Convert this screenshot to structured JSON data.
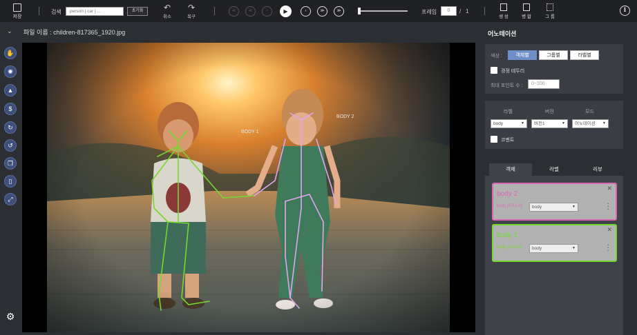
{
  "toolbar": {
    "save_label": "저장",
    "search_label": "검색",
    "search_placeholder": "person | car | ...",
    "reset_label": "초기화",
    "undo_label": "취소",
    "redo_label": "복구",
    "skip_back_2": "≪",
    "skip_back_1": "≪",
    "prev": "‹",
    "next": "›",
    "skip_fwd_1": "≫",
    "skip_fwd_2": "≫",
    "frame_label": "프레임",
    "frame_value": "0",
    "frame_sep": "/",
    "frame_total": "1",
    "create_label": "생 성",
    "merge_label": "병 합",
    "group_label": "그 룹",
    "info": "i"
  },
  "file": {
    "label": "파일 이름 : children-817365_1920.jpg"
  },
  "canvas_labels": {
    "body1": "BODY 1",
    "body2": "BODY 2"
  },
  "annotation": {
    "title": "어노테이션",
    "color_label": "색상 :",
    "color_buttons": [
      "객체별",
      "그룹별",
      "라벨별"
    ],
    "check_border": "경정 테두리",
    "max_points_label": "최대 포인트 수 :",
    "max_points_placeholder": "0~100",
    "label_header": "라벨",
    "version_header": "버전",
    "mode_header": "모드",
    "label_value": "body",
    "version_value": "버전1",
    "mode_value": "어노테이션",
    "comment_label": "코멘트",
    "tabs": [
      "객체",
      "라벨",
      "리뷰"
    ],
    "objects": [
      {
        "title": "body 2",
        "sub": "body (0,0,0,0)",
        "select": "body",
        "color": "#d867b6"
      },
      {
        "title": "body 1",
        "sub": "body (0,0,0,0)",
        "select": "body",
        "color": "#74d92e"
      }
    ]
  },
  "colors": {
    "body1": "#74d92e",
    "body2": "#e3a5f1",
    "accent": "#6f8fc9"
  }
}
